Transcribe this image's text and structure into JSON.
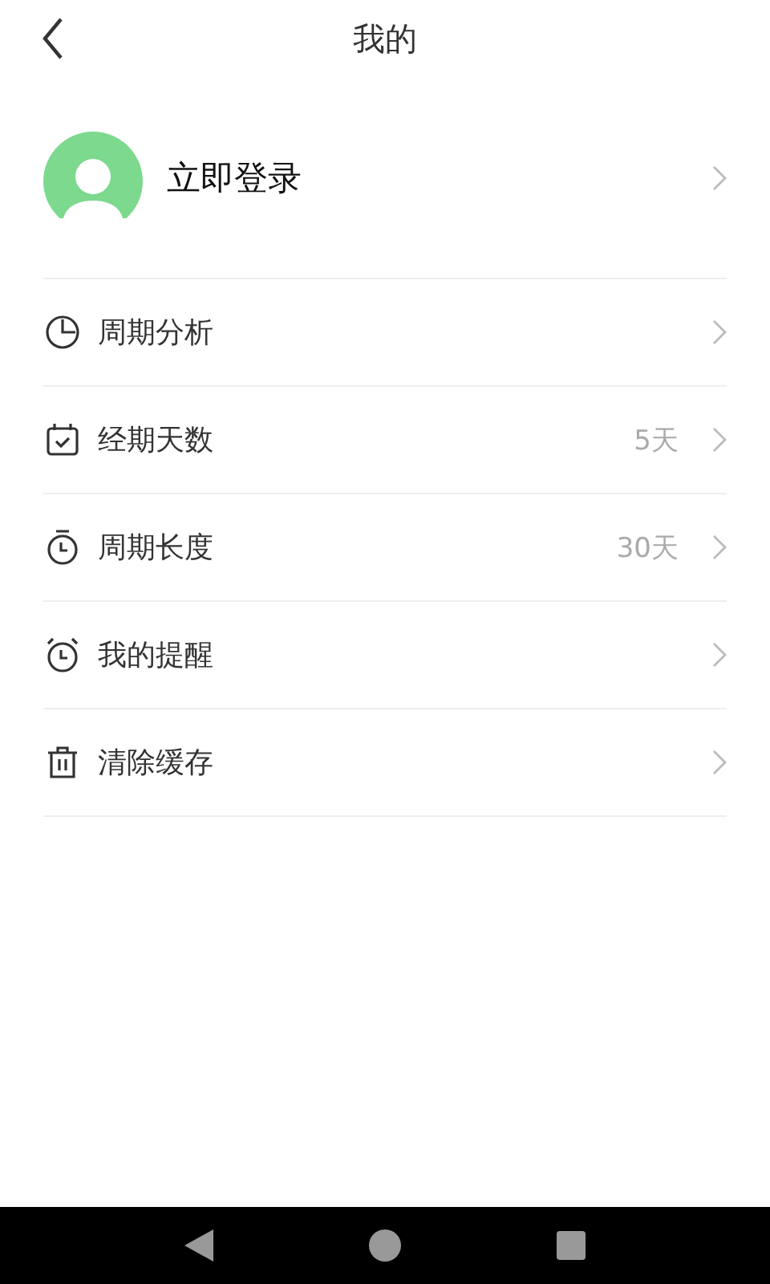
{
  "header": {
    "title": "我的"
  },
  "profile": {
    "label": "立即登录"
  },
  "items": [
    {
      "kind": "chart",
      "label": "周期分析"
    },
    {
      "kind": "calendar",
      "label": "经期天数",
      "value": "5天"
    },
    {
      "kind": "timer",
      "label": "周期长度",
      "value": "30天"
    },
    {
      "kind": "alarm",
      "label": "我的提醒"
    },
    {
      "kind": "trash",
      "label": "清除缓存"
    }
  ]
}
